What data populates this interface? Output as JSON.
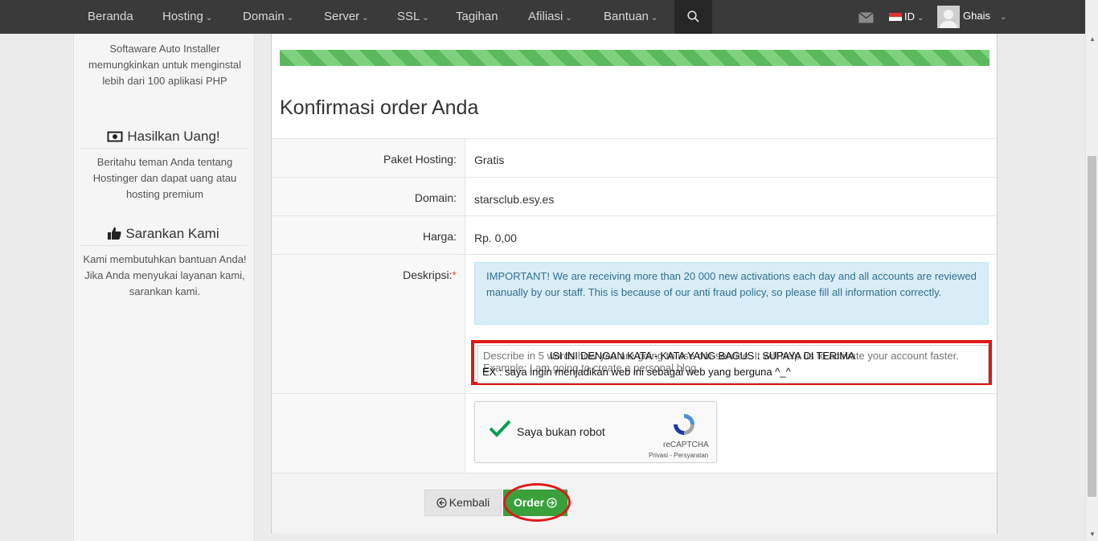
{
  "nav": {
    "items": [
      {
        "label": "Beranda",
        "dropdown": false
      },
      {
        "label": "Hosting",
        "dropdown": true
      },
      {
        "label": "Domain",
        "dropdown": true
      },
      {
        "label": "Server",
        "dropdown": true
      },
      {
        "label": "SSL",
        "dropdown": true
      },
      {
        "label": "Tagihan",
        "dropdown": false
      },
      {
        "label": "Afiliasi",
        "dropdown": true
      },
      {
        "label": "Bantuan",
        "dropdown": true
      }
    ],
    "language": "ID",
    "username": "Ghais"
  },
  "sidebar": {
    "intro_text": "Softaware Auto Installer memungkinkan untuk menginstal lebih dari 100 aplikasi PHP",
    "earn_heading": "Hasilkan Uang!",
    "earn_text": "Beritahu teman Anda tentang Hostinger dan dapat uang atau hosting premium",
    "suggest_heading": "Sarankan Kami",
    "suggest_text": "Kami membutuhkan bantuan Anda! Jika Anda menyukai layanan kami, sarankan kami."
  },
  "order": {
    "title": "Konfirmasi order Anda",
    "rows": [
      {
        "label": "Paket Hosting:",
        "value": "Gratis"
      },
      {
        "label": "Domain:",
        "value": "starsclub.esy.es"
      },
      {
        "label": "Harga:",
        "value": "Rp. 0,00"
      }
    ],
    "description_label": "Deskripsi:",
    "required_mark": "*",
    "important_notice": "IMPORTANT! We are receiving more than 20 000 new activations each day and all accounts are reviewed manually by our staff. This is because of our anti fraud policy, so please fill all information correctly.",
    "description_placeholder": "Describe in 5 words how you are going to use our service. It will help us to activate your account faster. Example: I am going to create a personal blog.",
    "overlay_line1": "ISI INI DENGAN KATA - KATA YANG BAGUS . SUPAYA DI TERIMA",
    "overlay_line2": "EX : saya ingin menjadikan web ini sebagai web yang berguna ^_^",
    "captcha_label": "Saya bukan robot",
    "captcha_brand": "reCAPTCHA",
    "captcha_terms": "Privasi - Persyaratan",
    "back_button": "Kembali",
    "order_button": "Order"
  },
  "colors": {
    "nav_bg": "#3a3a3a",
    "progress": "#5cb85c",
    "order_button": "#3aa13a",
    "annotation_red": "#e01818",
    "alert_bg": "#d9edf7"
  }
}
